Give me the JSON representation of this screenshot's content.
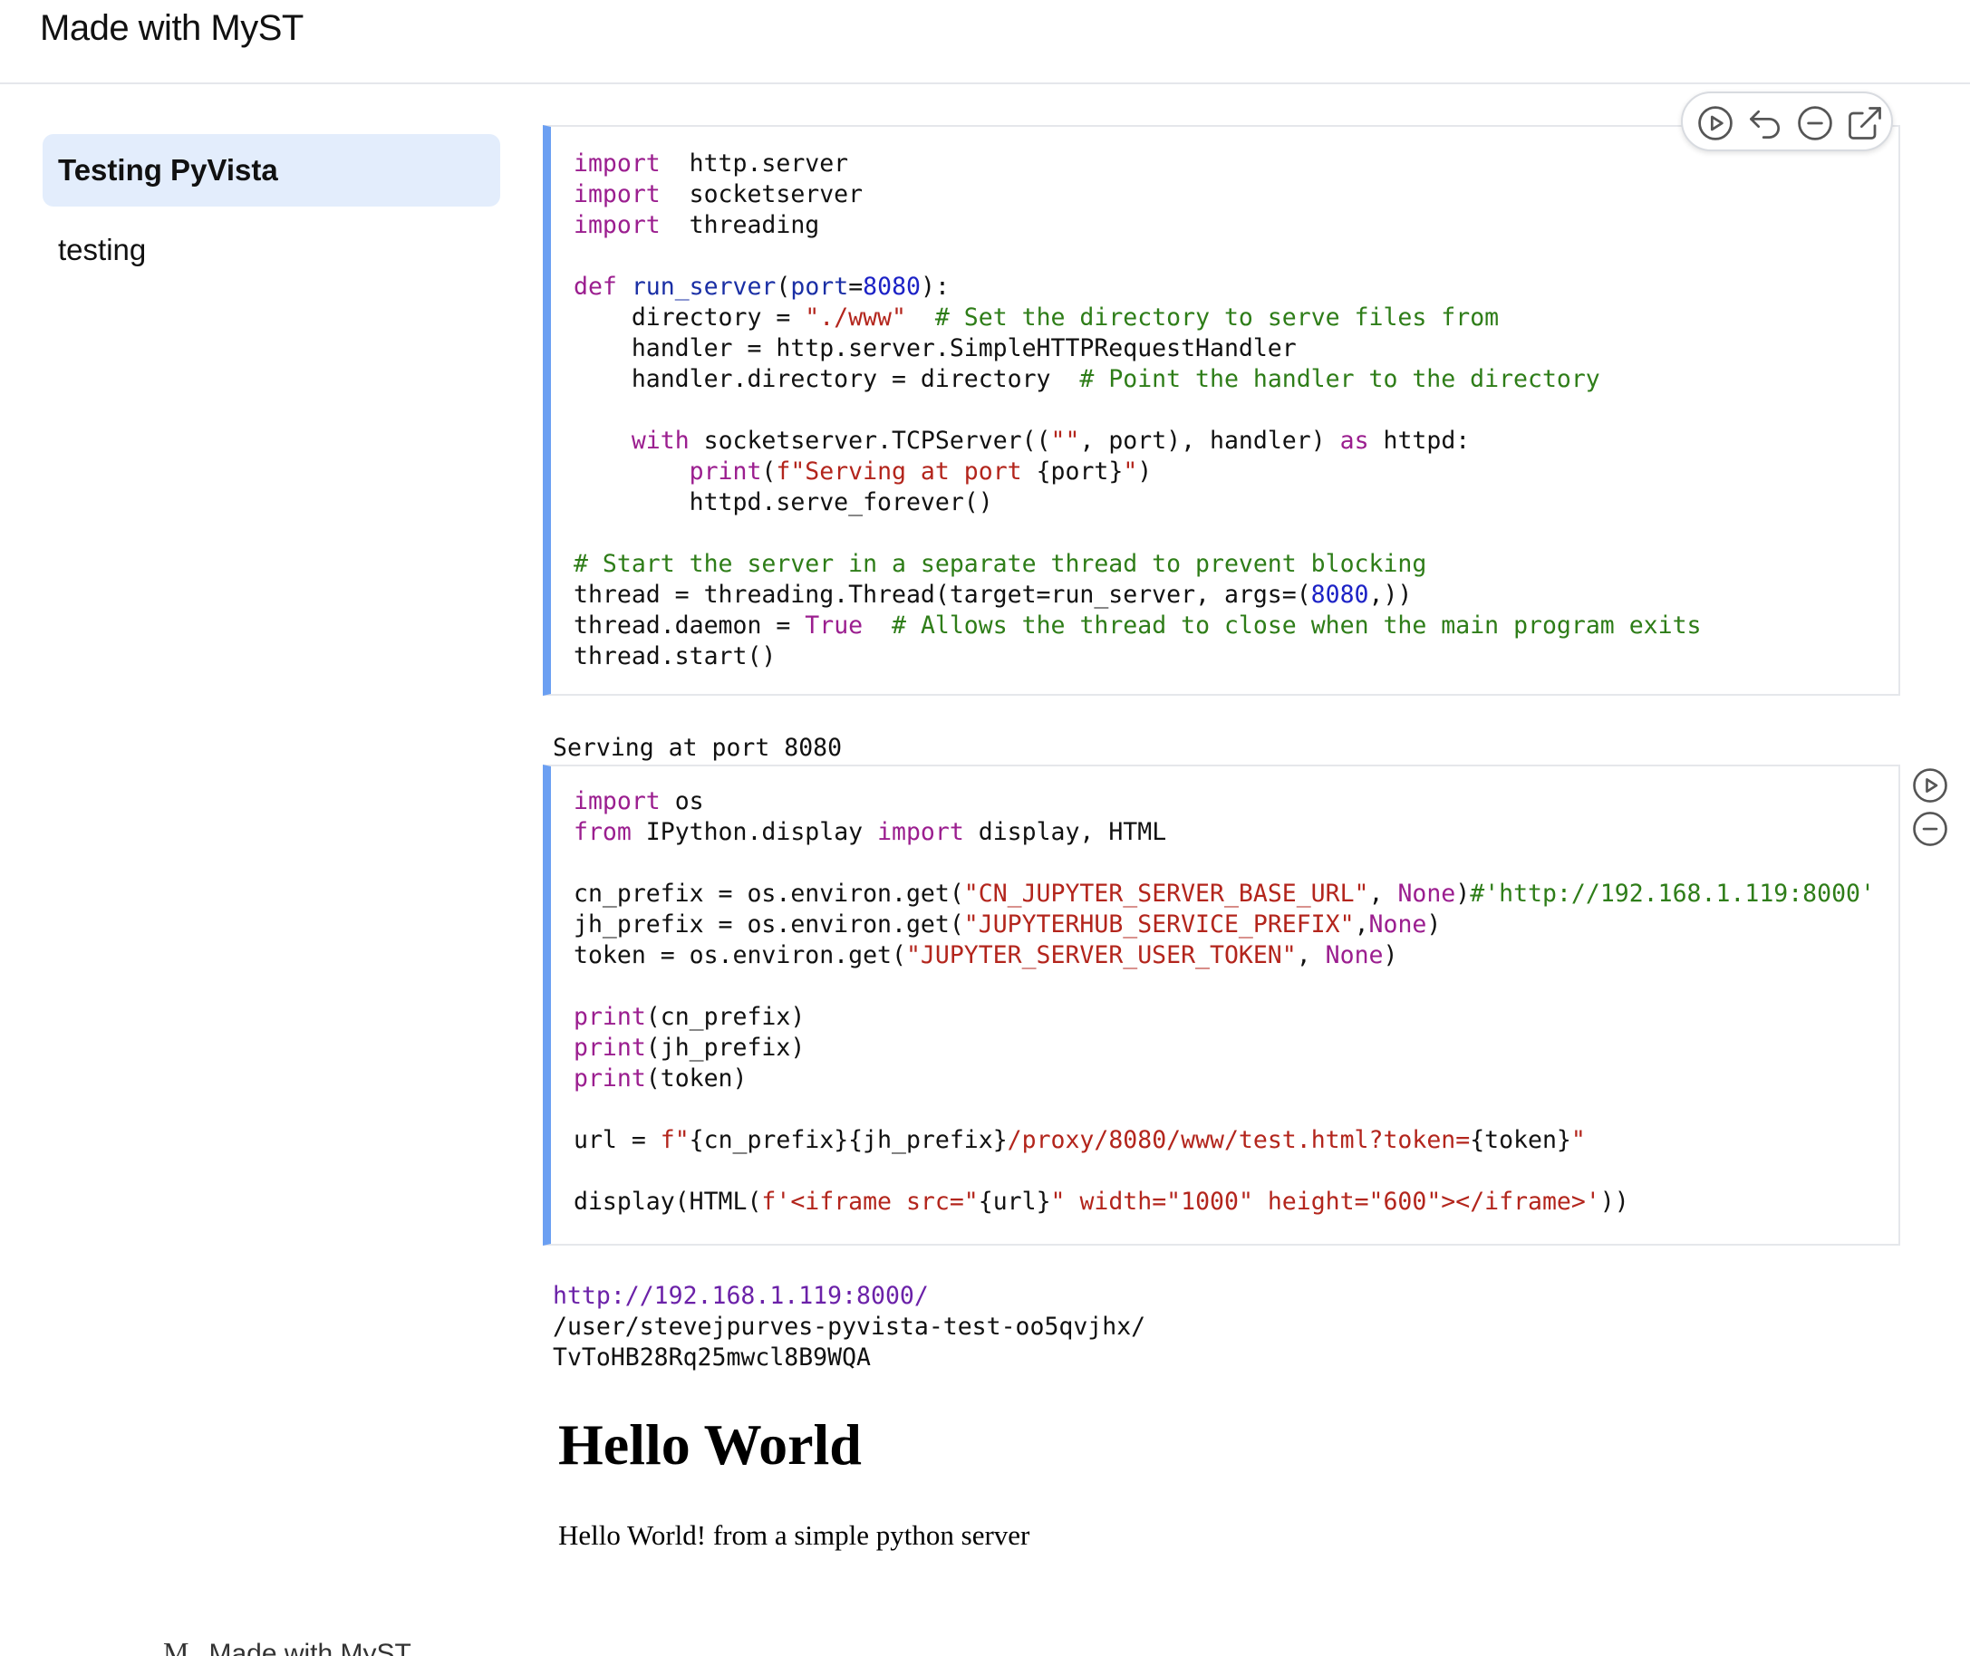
{
  "header": {
    "title": "Made with MyST"
  },
  "sidebar": {
    "items": [
      {
        "label": "Testing PyVista"
      },
      {
        "label": "testing"
      }
    ]
  },
  "cells": [
    {
      "lines": [
        [
          [
            "kw",
            "import"
          ],
          [
            "",
            "  http.server"
          ]
        ],
        [
          [
            "kw",
            "import"
          ],
          [
            "",
            "  socketserver"
          ]
        ],
        [
          [
            "kw",
            "import"
          ],
          [
            "",
            "  threading"
          ]
        ],
        [],
        [
          [
            "kw",
            "def"
          ],
          [
            "",
            " "
          ],
          [
            "fn",
            "run_server"
          ],
          [
            "",
            "("
          ],
          [
            "fn",
            "port"
          ],
          [
            "",
            "="
          ],
          [
            "num",
            "8080"
          ],
          [
            "",
            "):"
          ]
        ],
        [
          [
            "",
            "    directory = "
          ],
          [
            "str",
            "\"./www\""
          ],
          [
            "",
            "  "
          ],
          [
            "cmt",
            "# Set the directory to serve files from"
          ]
        ],
        [
          [
            "",
            "    handler = http.server.SimpleHTTPRequestHandler"
          ]
        ],
        [
          [
            "",
            "    handler.directory = directory  "
          ],
          [
            "cmt",
            "# Point the handler to the directory"
          ]
        ],
        [],
        [
          [
            "",
            "    "
          ],
          [
            "kw",
            "with"
          ],
          [
            "",
            " socketserver.TCPServer(("
          ],
          [
            "str",
            "\"\""
          ],
          [
            "",
            ", port), handler) "
          ],
          [
            "kw",
            "as"
          ],
          [
            "",
            " httpd:"
          ]
        ],
        [
          [
            "",
            "        "
          ],
          [
            "bi",
            "print"
          ],
          [
            "",
            "("
          ],
          [
            "str",
            "f\"Serving at port "
          ],
          [
            "",
            "{port}"
          ],
          [
            "str",
            "\""
          ],
          [
            "",
            ")"
          ]
        ],
        [
          [
            "",
            "        httpd.serve_forever()"
          ]
        ],
        [],
        [
          [
            "cmt",
            "# Start the server in a separate thread to prevent blocking"
          ]
        ],
        [
          [
            "",
            "thread = threading.Thread(target=run_server, args=("
          ],
          [
            "num",
            "8080"
          ],
          [
            "",
            ",))"
          ]
        ],
        [
          [
            "",
            "thread.daemon = "
          ],
          [
            "kw",
            "True"
          ],
          [
            "",
            "  "
          ],
          [
            "cmt",
            "# Allows the thread to close when the main program exits"
          ]
        ],
        [
          [
            "",
            "thread.start()"
          ]
        ]
      ]
    },
    {
      "lines": [
        [
          [
            "kw",
            "import"
          ],
          [
            "",
            " os"
          ]
        ],
        [
          [
            "kw",
            "from"
          ],
          [
            "",
            " IPython.display "
          ],
          [
            "kw",
            "import"
          ],
          [
            "",
            " display, HTML"
          ]
        ],
        [],
        [
          [
            "",
            "cn_prefix = os.environ.get("
          ],
          [
            "str",
            "\"CN_JUPYTER_SERVER_BASE_URL\""
          ],
          [
            "",
            ", "
          ],
          [
            "kw",
            "None"
          ],
          [
            "",
            ")"
          ],
          [
            "cmt",
            "#'http://192.168.1.119:8000'"
          ]
        ],
        [
          [
            "",
            "jh_prefix = os.environ.get("
          ],
          [
            "str",
            "\"JUPYTERHUB_SERVICE_PREFIX\""
          ],
          [
            "",
            ","
          ],
          [
            "kw",
            "None"
          ],
          [
            "",
            ")"
          ]
        ],
        [
          [
            "",
            "token = os.environ.get("
          ],
          [
            "str",
            "\"JUPYTER_SERVER_USER_TOKEN\""
          ],
          [
            "",
            ", "
          ],
          [
            "kw",
            "None"
          ],
          [
            "",
            ")"
          ]
        ],
        [],
        [
          [
            "bi",
            "print"
          ],
          [
            "",
            "(cn_prefix)"
          ]
        ],
        [
          [
            "bi",
            "print"
          ],
          [
            "",
            "(jh_prefix)"
          ]
        ],
        [
          [
            "bi",
            "print"
          ],
          [
            "",
            "(token)"
          ]
        ],
        [],
        [
          [
            "",
            "url = "
          ],
          [
            "str",
            "f\""
          ],
          [
            "",
            "{cn_prefix}{jh_prefix}"
          ],
          [
            "str",
            "/proxy/8080/www/test.html?token="
          ],
          [
            "",
            "{token}"
          ],
          [
            "str",
            "\""
          ]
        ],
        [],
        [
          [
            "",
            "display(HTML("
          ],
          [
            "str",
            "f'<iframe src=\""
          ],
          [
            "",
            "{url}"
          ],
          [
            "str",
            "\" width=\"1000\" height=\"600\"></iframe>'"
          ],
          [
            "",
            "))"
          ]
        ]
      ]
    }
  ],
  "outputs": {
    "stream1": "Serving at port 8080",
    "stream2": {
      "url": "http://192.168.1.119:8000/",
      "prefix": "/user/stevejpurves-pyvista-test-oo5qvjhx/",
      "token": "TvToHB28Rq25mwcl8B9WQA"
    }
  },
  "html_output": {
    "heading": "Hello World",
    "paragraph": "Hello World! from a simple python server"
  },
  "footer": {
    "logo": "M",
    "label": "Made with MyST"
  },
  "colors": {
    "accent": "#6b9ff2",
    "active_bg": "#e3edfc",
    "keyword": "#9b1e8f",
    "string": "#b3251c",
    "comment": "#2e7d18",
    "number": "#1c22c6"
  },
  "icons": {
    "toolbar": [
      "play-circle-icon",
      "undo-icon",
      "minus-circle-icon",
      "external-link-icon"
    ],
    "cell2": [
      "play-circle-icon",
      "minus-circle-icon"
    ]
  }
}
